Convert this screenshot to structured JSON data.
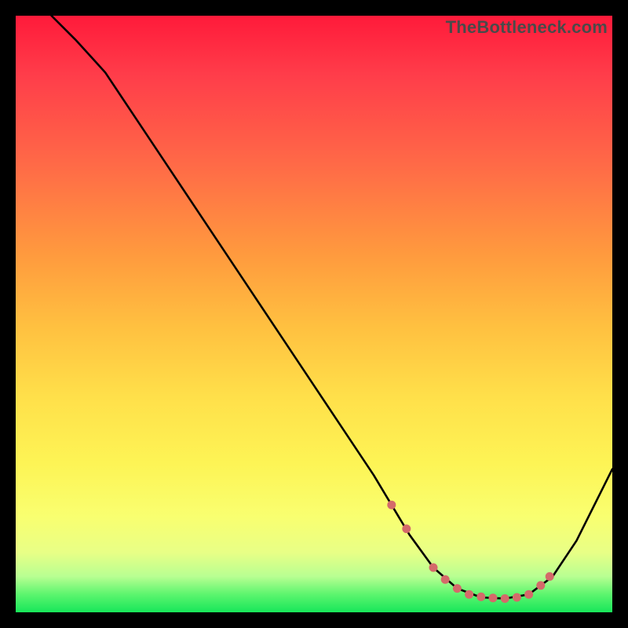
{
  "watermark": "TheBottleneck.com",
  "chart_data": {
    "type": "line",
    "title": "",
    "xlabel": "",
    "ylabel": "",
    "xlim": [
      0,
      100
    ],
    "ylim": [
      0,
      100
    ],
    "grid": false,
    "note": "Values are read off the image in plot coordinates (0–100 each axis, y=0 at bottom). Curve is a single series; markers are the salmon dots near the trough.",
    "series": [
      {
        "name": "curve",
        "x": [
          6,
          10,
          15,
          20,
          25,
          30,
          35,
          40,
          45,
          50,
          55,
          60,
          63,
          66,
          70,
          74,
          78,
          82,
          86,
          90,
          94,
          100
        ],
        "y": [
          100,
          96,
          90.5,
          83,
          75.5,
          68,
          60.5,
          53,
          45.5,
          38,
          30.5,
          23,
          18,
          13,
          7.5,
          4,
          2.5,
          2.3,
          3,
          6,
          12,
          24
        ]
      }
    ],
    "markers": {
      "name": "trough-dots",
      "color": "#d46a6a",
      "x": [
        63,
        65.5,
        70,
        72,
        74,
        76,
        78,
        80,
        82,
        84,
        86,
        88,
        89.5
      ],
      "y": [
        18,
        14,
        7.5,
        5.5,
        4,
        3,
        2.6,
        2.4,
        2.3,
        2.5,
        3,
        4.5,
        6
      ]
    },
    "gradient_stops": [
      {
        "pos": 0,
        "color": "#ff1a3a"
      },
      {
        "pos": 10,
        "color": "#ff3d4a"
      },
      {
        "pos": 25,
        "color": "#ff6a47"
      },
      {
        "pos": 40,
        "color": "#ff9a3e"
      },
      {
        "pos": 52,
        "color": "#ffc040"
      },
      {
        "pos": 64,
        "color": "#ffe04a"
      },
      {
        "pos": 75,
        "color": "#fdf455"
      },
      {
        "pos": 84,
        "color": "#f9ff70"
      },
      {
        "pos": 90,
        "color": "#e8ff86"
      },
      {
        "pos": 94,
        "color": "#b8ff92"
      },
      {
        "pos": 97,
        "color": "#5cf56e"
      },
      {
        "pos": 100,
        "color": "#17e65a"
      }
    ]
  }
}
